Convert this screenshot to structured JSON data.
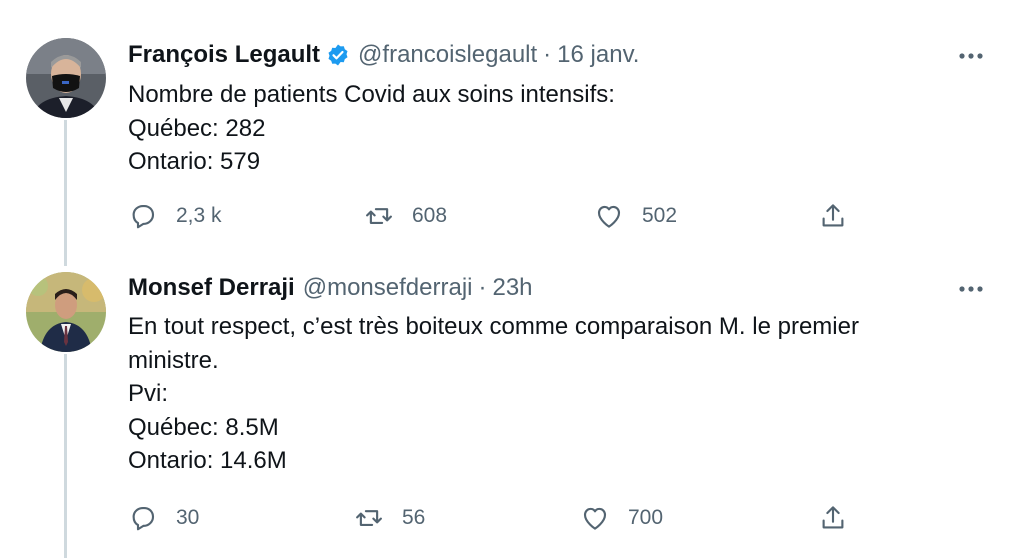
{
  "tweets": [
    {
      "name": "François Legault",
      "verified": true,
      "handle": "@francoislegault",
      "separator": "·",
      "date": "16 janv.",
      "lines": [
        "Nombre de patients Covid aux soins intensifs:",
        "Québec: 282",
        "Ontario: 579"
      ],
      "replies": "2,3 k",
      "retweets": "608",
      "likes": "502"
    },
    {
      "name": "Monsef Derraji",
      "verified": false,
      "handle": "@monsefderraji",
      "separator": "·",
      "date": "23h",
      "lines": [
        "En tout respect, c’est très boiteux comme comparaison M. le premier",
        "ministre.",
        "Pvi:",
        "Québec: 8.5M",
        "Ontario: 14.6M"
      ],
      "replies": "30",
      "retweets": "56",
      "likes": "700"
    }
  ],
  "icons": {
    "verified": "verified-badge-icon",
    "more": "more-horizontal-icon",
    "reply": "reply-icon",
    "retweet": "retweet-icon",
    "like": "heart-icon",
    "share": "share-icon"
  },
  "colors": {
    "text": "#0f1419",
    "secondary": "#536471",
    "verified": "#1d9bf0",
    "thread_line": "#cfd9de"
  }
}
